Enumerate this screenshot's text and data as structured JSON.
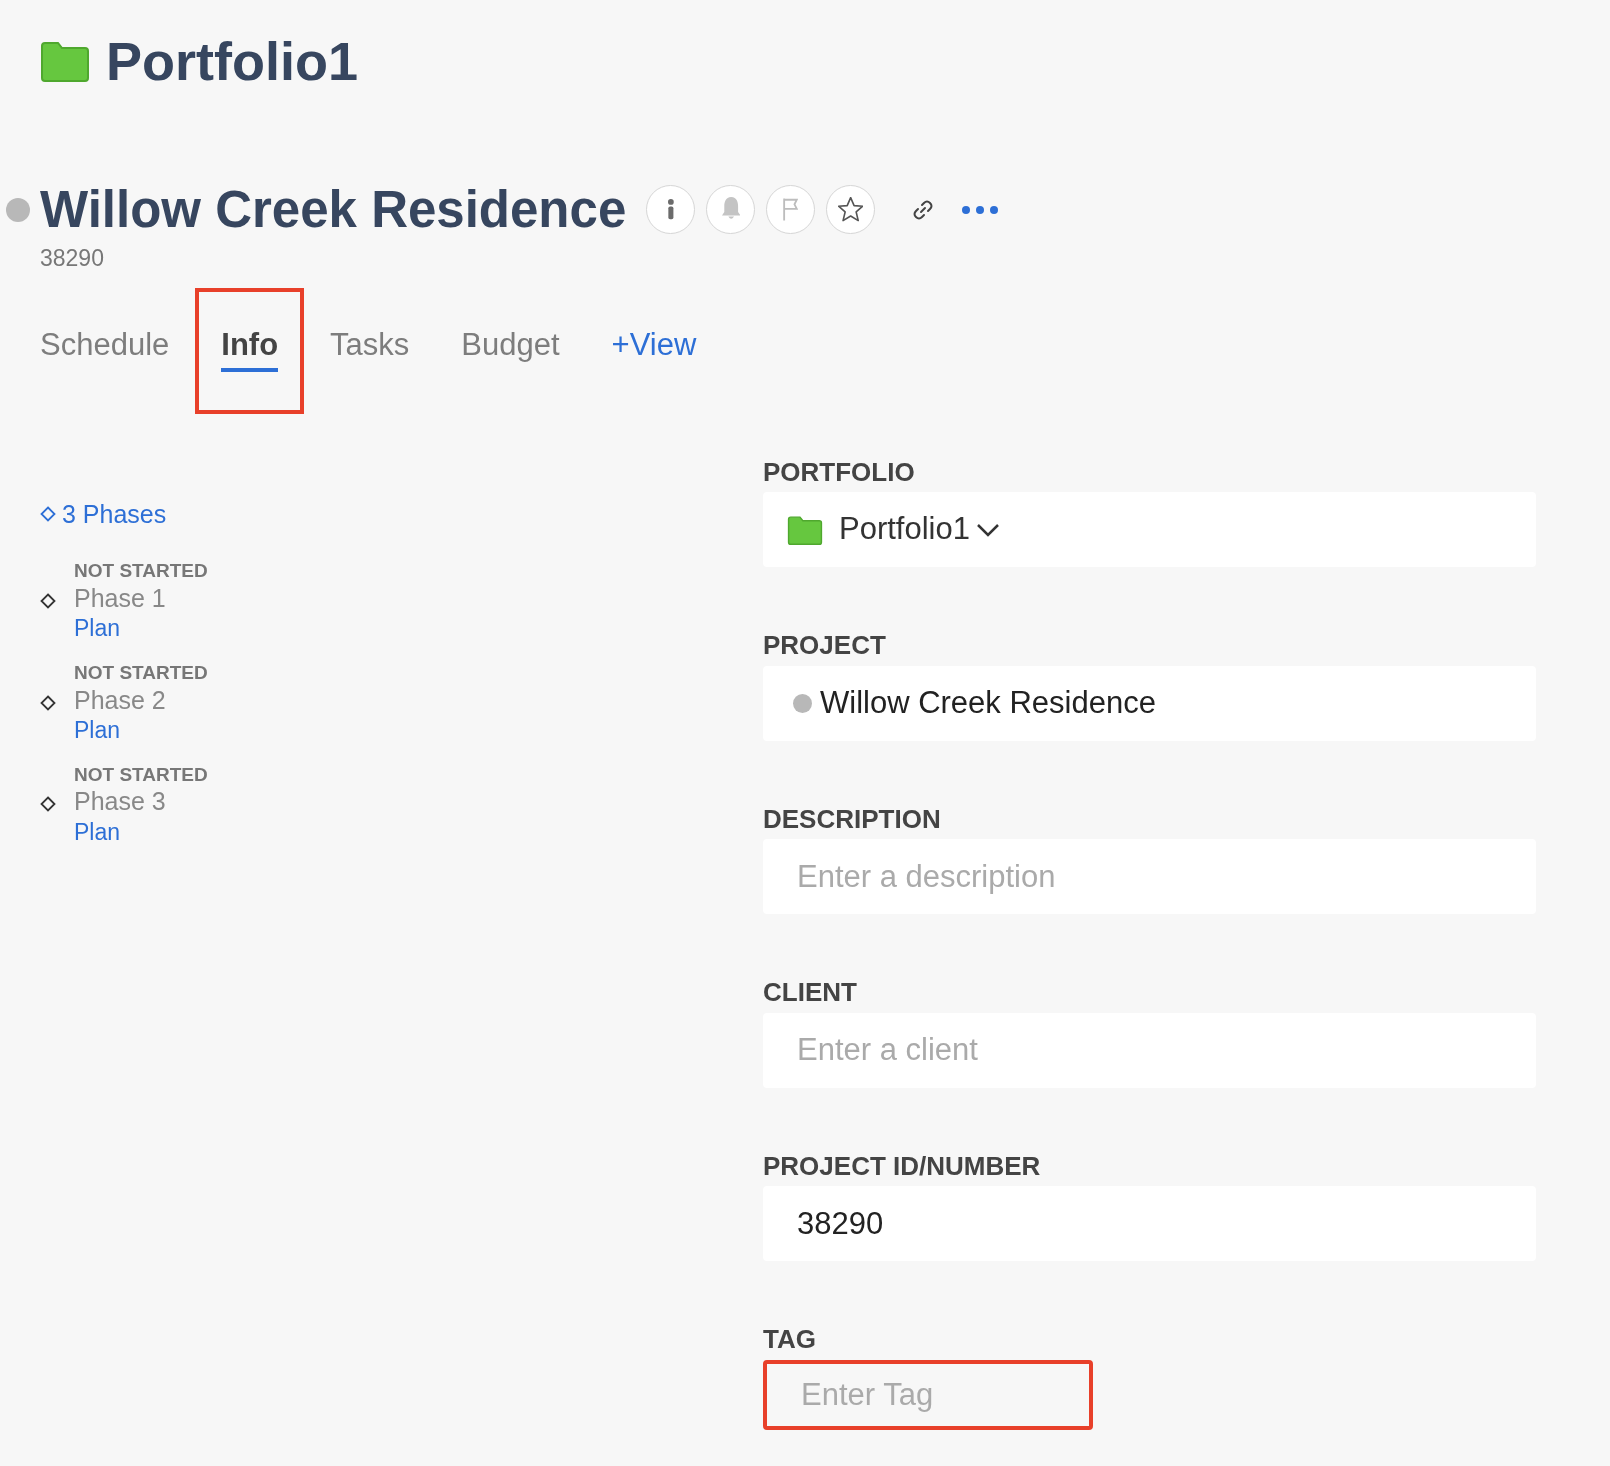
{
  "portfolio": {
    "title": "Portfolio1"
  },
  "project": {
    "title": "Willow Creek Residence",
    "number": "38290"
  },
  "header_actions": [
    {
      "kind": "info"
    },
    {
      "kind": "bell"
    },
    {
      "kind": "flag"
    },
    {
      "kind": "star"
    },
    {
      "kind": "link"
    },
    {
      "kind": "more"
    }
  ],
  "tabs": [
    {
      "label": "Schedule",
      "selected": false,
      "highlighted": false
    },
    {
      "label": "Info",
      "selected": true,
      "highlighted": true
    },
    {
      "label": "Tasks",
      "selected": false,
      "highlighted": false
    },
    {
      "label": "Budget",
      "selected": false,
      "highlighted": false
    }
  ],
  "add_view": "+View",
  "phases": {
    "summary": "3 Phases",
    "items": [
      {
        "status": "NOT STARTED",
        "name": "Phase 1",
        "link": "Plan"
      },
      {
        "status": "NOT STARTED",
        "name": "Phase 2",
        "link": "Plan"
      },
      {
        "status": "NOT STARTED",
        "name": "Phase 3",
        "link": "Plan"
      }
    ]
  },
  "fields": [
    {
      "kind": "portfolio",
      "label": "PORTFOLIO",
      "value": "Portfolio1",
      "highlighted": false
    },
    {
      "kind": "project",
      "label": "PROJECT",
      "value": "Willow Creek Residence",
      "highlighted": false
    },
    {
      "kind": "text",
      "label": "DESCRIPTION",
      "placeholder": "Enter a description",
      "highlighted": false
    },
    {
      "kind": "text",
      "label": "CLIENT",
      "placeholder": "Enter a client",
      "highlighted": false
    },
    {
      "kind": "text",
      "label": "PROJECT ID/NUMBER",
      "value": "38290",
      "highlighted": false
    },
    {
      "kind": "tag",
      "label": "TAG",
      "placeholder": "Enter Tag",
      "highlighted": true
    }
  ]
}
